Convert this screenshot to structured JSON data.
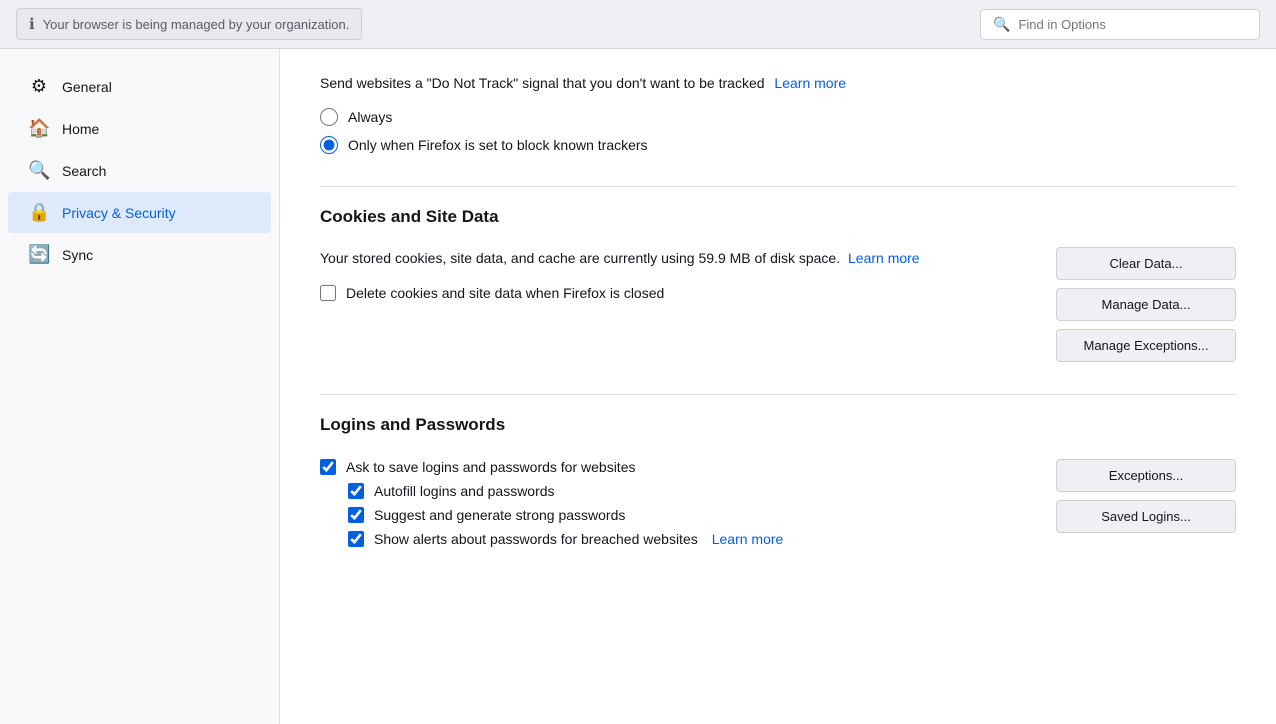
{
  "topbar": {
    "managed_notice": "Your browser is being managed by your organization.",
    "find_placeholder": "Find in Options"
  },
  "sidebar": {
    "items": [
      {
        "id": "general",
        "label": "General",
        "icon": "⚙"
      },
      {
        "id": "home",
        "label": "Home",
        "icon": "🏠"
      },
      {
        "id": "search",
        "label": "Search",
        "icon": "🔍"
      },
      {
        "id": "privacy",
        "label": "Privacy & Security",
        "icon": "🔒",
        "active": true
      },
      {
        "id": "sync",
        "label": "Sync",
        "icon": "🔄"
      }
    ]
  },
  "content": {
    "dnt": {
      "text": "Send websites a \"Do Not Track\" signal that you don't want to be tracked",
      "learn_more": "Learn more",
      "options": [
        {
          "id": "always",
          "label": "Always",
          "checked": false
        },
        {
          "id": "only_when",
          "label": "Only when Firefox is set to block known trackers",
          "checked": true
        }
      ]
    },
    "cookies": {
      "title": "Cookies and Site Data",
      "desc": "Your stored cookies, site data, and cache are currently using 59.9 MB of disk space.",
      "learn_more": "Learn more",
      "delete_label": "Delete cookies and site data when Firefox is closed",
      "delete_checked": false,
      "buttons": [
        {
          "id": "clear-data",
          "label": "Clear Data..."
        },
        {
          "id": "manage-data",
          "label": "Manage Data..."
        },
        {
          "id": "manage-exceptions",
          "label": "Manage Exceptions..."
        }
      ]
    },
    "logins": {
      "title": "Logins and Passwords",
      "ask_save": "Ask to save logins and passwords for websites",
      "ask_save_checked": true,
      "sub_options": [
        {
          "id": "autofill",
          "label": "Autofill logins and passwords",
          "checked": true
        },
        {
          "id": "suggest",
          "label": "Suggest and generate strong passwords",
          "checked": true
        }
      ],
      "last_option": {
        "label": "Show alerts about passwords for breached websites",
        "checked": true,
        "learn_more": "Learn more"
      },
      "buttons": [
        {
          "id": "exceptions",
          "label": "Exceptions..."
        },
        {
          "id": "saved-logins",
          "label": "Saved Logins..."
        }
      ]
    }
  }
}
